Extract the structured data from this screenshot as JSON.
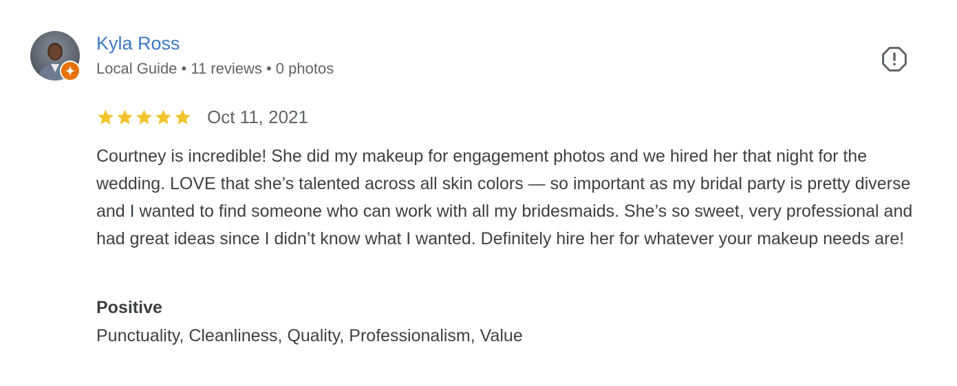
{
  "reviewer": {
    "name": "Kyla Ross",
    "meta": "Local Guide • 11 reviews • 0 photos",
    "avatar_icon": "profile-photo",
    "badge_icon": "local-guide-star-icon"
  },
  "actions": {
    "report_icon": "report-exclamation-icon"
  },
  "review": {
    "rating": 5,
    "rating_max": 5,
    "date": "Oct 11, 2021",
    "text": "Courtney is incredible! She did my makeup for engagement photos and we hired her that night for the wedding. LOVE that she’s talented across all skin colors — so important as my bridal party is pretty diverse and I wanted to find someone who can work with all my bridesmaids. She’s so sweet, very professional and had great ideas since I didn’t know what I wanted. Definitely hire her for whatever your makeup needs are!"
  },
  "attributes": {
    "heading": "Positive",
    "values": "Punctuality, Cleanliness, Quality, Professionalism, Value"
  },
  "colors": {
    "name_link": "#3b78c4",
    "star": "#f4c22b",
    "badge": "#e8710a",
    "secondary_text": "#5f6368",
    "body_text": "#3c4043"
  }
}
